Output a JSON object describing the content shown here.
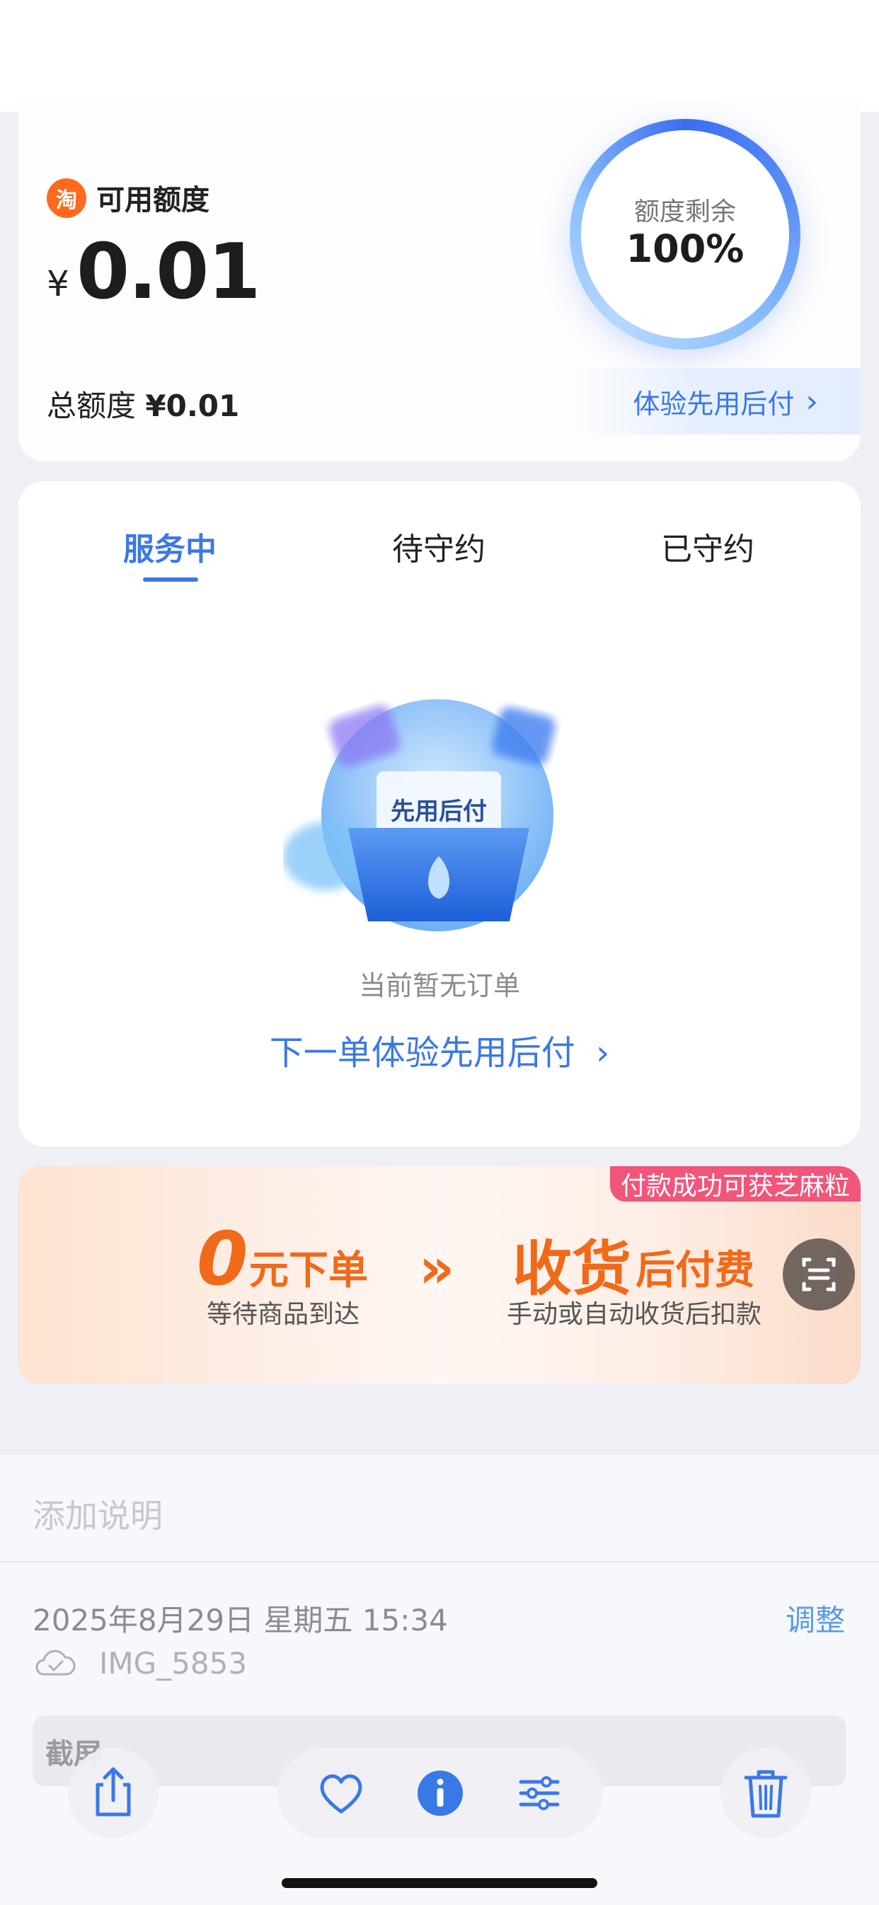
{
  "credit": {
    "logo_char": "淘",
    "available_label": "可用额度",
    "currency": "¥",
    "available_amount": "0.01",
    "total_label": "总额度",
    "total_amount": "¥0.01",
    "ring_label": "额度剩余",
    "ring_value": "100%",
    "try_link": "体验先用后付"
  },
  "tabs": [
    {
      "label": "服务中",
      "active": true
    },
    {
      "label": "待守约",
      "active": false
    },
    {
      "label": "已守约",
      "active": false
    }
  ],
  "empty": {
    "illustration_text": "先用后付",
    "message": "当前暂无订单",
    "link": "下一单体验先用后付"
  },
  "banner": {
    "badge": "付款成功可获芝麻粒",
    "left_big": "0",
    "left_title": "元下单",
    "left_sub": "等待商品到达",
    "arrow": "»",
    "right_big": "收货",
    "right_title": "后付费",
    "right_sub": "手动或自动收货后扣款"
  },
  "photo_info": {
    "caption_placeholder": "添加说明",
    "date": "2025年8月29日 星期五 15:34",
    "adjust_label": "调整",
    "filename": "IMG_5853",
    "section_label": "截屏"
  },
  "colors": {
    "accent_blue": "#3b78e7",
    "banner_orange": "#f06a1a",
    "badge_pink": "#f2557a"
  },
  "icons": [
    "share-icon",
    "heart-icon",
    "info-icon",
    "sliders-icon",
    "trash-icon",
    "scan-icon",
    "cloud-check-icon"
  ]
}
